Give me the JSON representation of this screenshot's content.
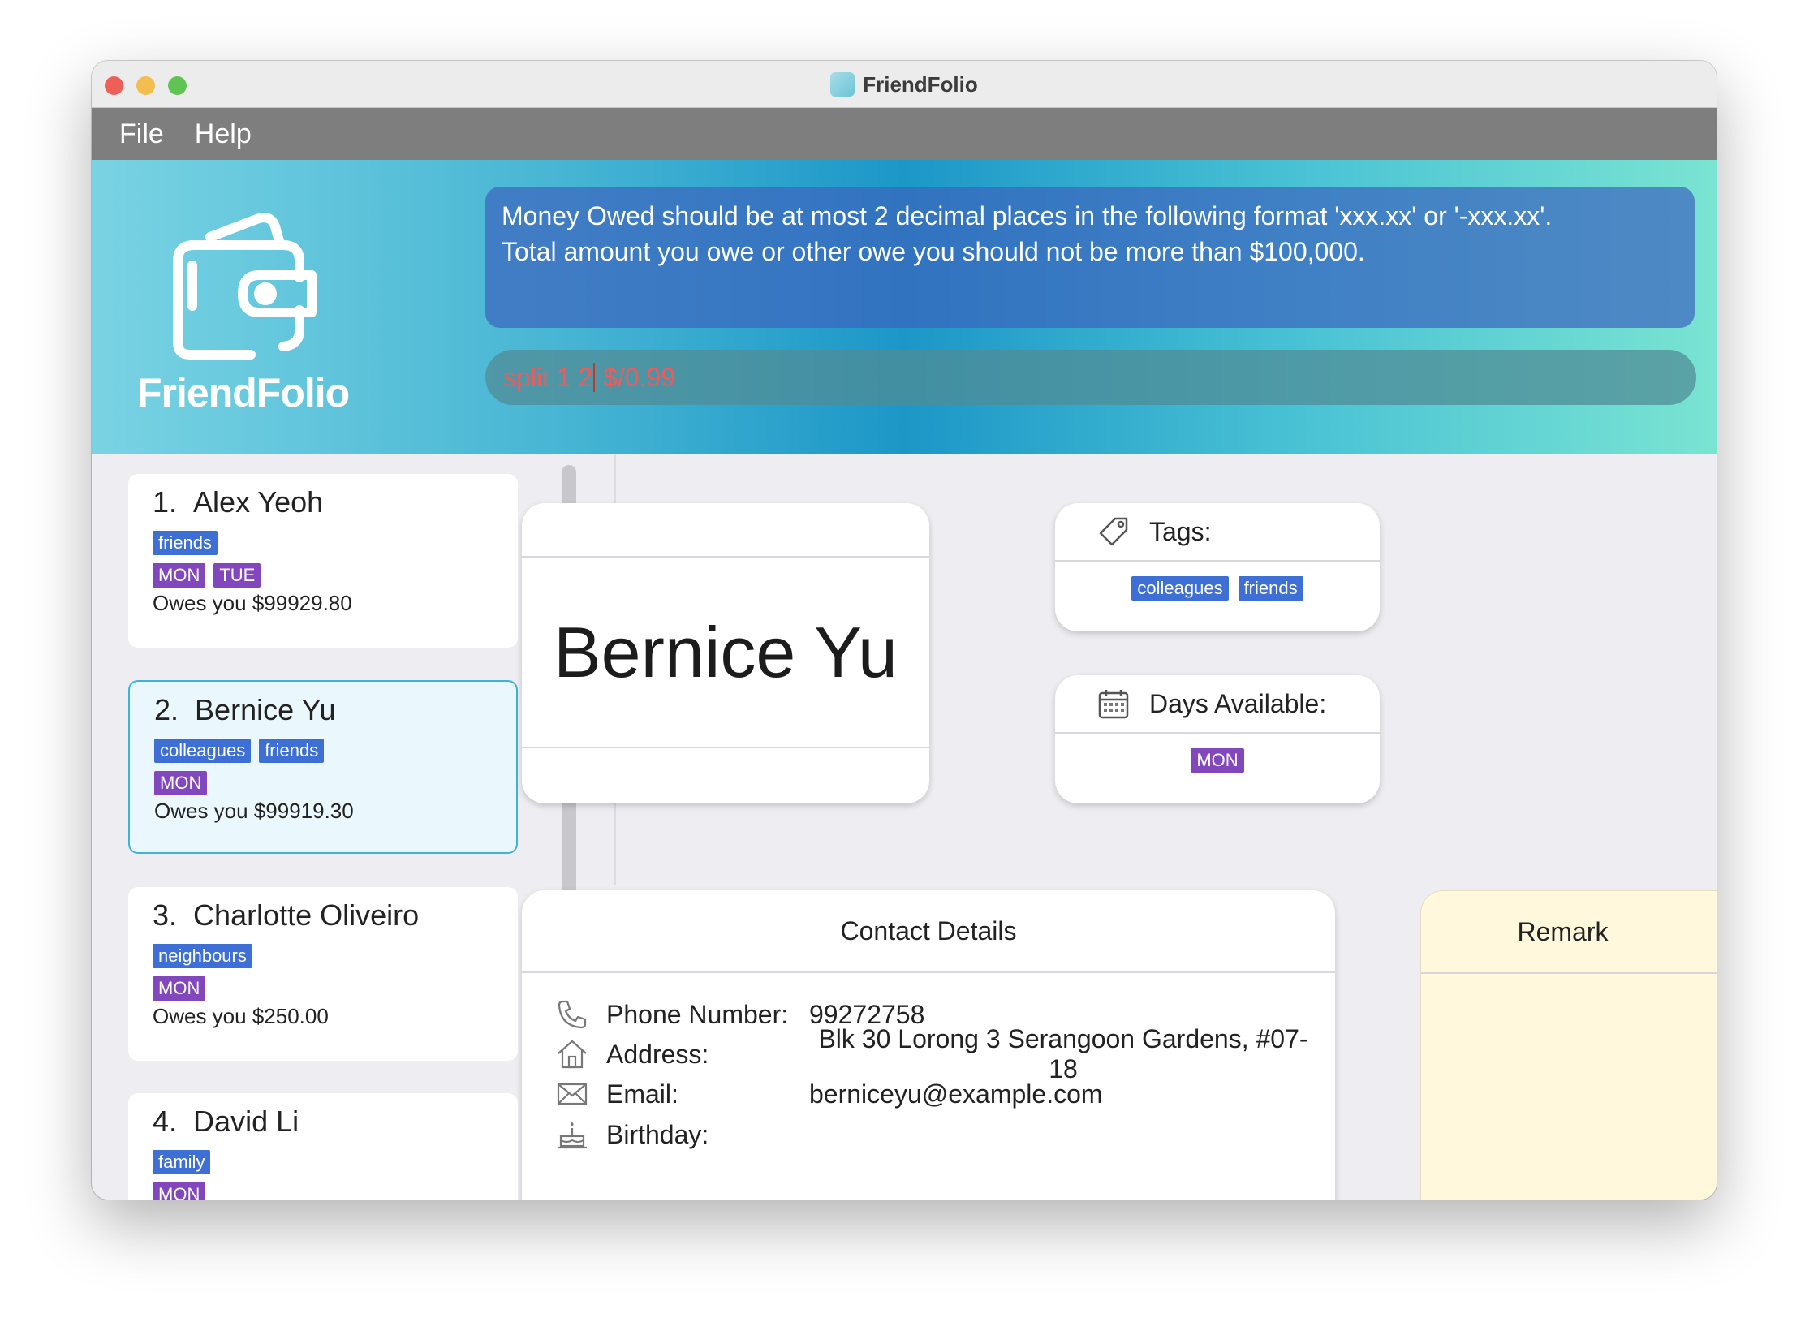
{
  "window": {
    "title": "FriendFolio"
  },
  "menu": [
    "File",
    "Help"
  ],
  "banner": {
    "logo_text": "FriendFolio",
    "result_lines": [
      "Money Owed should be at most 2 decimal places in the following format 'xxx.xx' or '-xxx.xx'.",
      "Total amount you owe or other owe you should not be more than $100,000."
    ],
    "command_before_caret": "split 1 2",
    "command_after_caret": " $/0.99"
  },
  "persons": [
    {
      "index": "1.",
      "name": "Alex Yeoh",
      "tags": [
        "friends"
      ],
      "days": [
        "MON",
        "TUE"
      ],
      "owes": "Owes you $99929.80"
    },
    {
      "index": "2.",
      "name": "Bernice Yu",
      "tags": [
        "colleagues",
        "friends"
      ],
      "days": [
        "MON"
      ],
      "owes": "Owes you $99919.30"
    },
    {
      "index": "3.",
      "name": "Charlotte Oliveiro",
      "tags": [
        "neighbours"
      ],
      "days": [
        "MON"
      ],
      "owes": "Owes you $250.00"
    },
    {
      "index": "4.",
      "name": "David Li",
      "tags": [
        "family"
      ],
      "days": [
        "MON"
      ],
      "owes": ""
    }
  ],
  "detail": {
    "name": "Bernice Yu",
    "tags_label": "Tags:",
    "tags": [
      "colleagues",
      "friends"
    ],
    "days_label": "Days Available:",
    "days": [
      "MON"
    ],
    "contact_title": "Contact Details",
    "phone_label": "Phone Number:",
    "phone": "99272758",
    "address_label": "Address:",
    "address": "Blk 30 Lorong 3 Serangoon Gardens, #07-18",
    "email_label": "Email:",
    "email": "berniceyu@example.com",
    "birthday_label": "Birthday:",
    "birthday": "",
    "remark_title": "Remark"
  },
  "colors": {
    "tag": "#3d6fd4",
    "day": "#8247bd",
    "selected_border": "#3cb3d9",
    "error_text": "#f05a5a"
  }
}
